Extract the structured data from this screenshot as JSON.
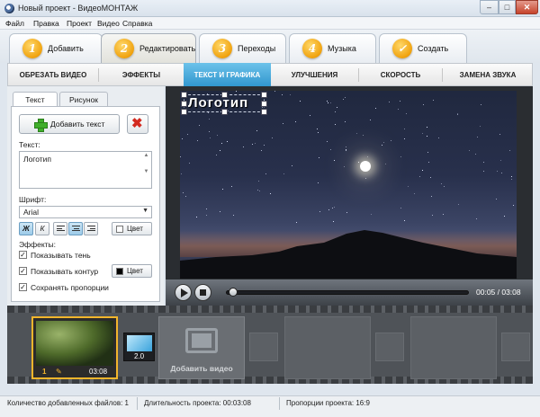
{
  "window": {
    "title": "Новый проект - ВидеоМОНТАЖ",
    "minimize": "–",
    "maximize": "□",
    "close": "✕"
  },
  "menu": [
    "Файл",
    "Правка",
    "Проект",
    "Видео",
    "Справка"
  ],
  "steps": [
    {
      "num": "1",
      "label": "Добавить",
      "active": false
    },
    {
      "num": "2",
      "label": "Редактировать",
      "active": true
    },
    {
      "num": "3",
      "label": "Переходы",
      "active": false
    },
    {
      "num": "4",
      "label": "Музыка",
      "active": false
    },
    {
      "num": "✓",
      "label": "Создать",
      "active": false
    }
  ],
  "subtabs": [
    {
      "label": "ОБРЕЗАТЬ ВИДЕО",
      "active": false
    },
    {
      "label": "ЭФФЕКТЫ",
      "active": false
    },
    {
      "label": "ТЕКСТ И ГРАФИКА",
      "active": true
    },
    {
      "label": "УЛУЧШЕНИЯ",
      "active": false
    },
    {
      "label": "СКОРОСТЬ",
      "active": false
    },
    {
      "label": "ЗАМЕНА ЗВУКА",
      "active": false
    }
  ],
  "panel": {
    "tabs": [
      {
        "label": "Текст",
        "active": true
      },
      {
        "label": "Рисунок",
        "active": false
      }
    ],
    "add_text_label": "Добавить текст",
    "text_label": "Текст:",
    "text_value": "Логотип",
    "font_label": "Шрифт:",
    "font_value": "Arial",
    "bold_label": "Ж",
    "italic_label": "К",
    "color_label": "Цвет",
    "text_color": "#ffffff",
    "outline_color": "#000000",
    "effects_label": "Эффекты:",
    "options": [
      {
        "label": "Показывать тень",
        "checked": true
      },
      {
        "label": "Показывать контур",
        "checked": true
      },
      {
        "label": "Сохранять пропорции",
        "checked": true
      }
    ]
  },
  "preview": {
    "overlay_text": "Логотип",
    "time_display": "00:05 / 03:08",
    "progress": 0.03
  },
  "timeline": {
    "clip": {
      "number": "1",
      "duration": "03:08"
    },
    "transition_value": "2.0",
    "add_video_label": "Добавить видео"
  },
  "status": {
    "files": "Количество добавленных файлов: 1",
    "duration": "Длительность проекта:  00:03:08",
    "aspect": "Пропорции проекта:  16:9"
  },
  "colors": {
    "accent": "#2f95cd",
    "step_badge": "#f0a20e",
    "clip_border": "#f2b52c"
  }
}
